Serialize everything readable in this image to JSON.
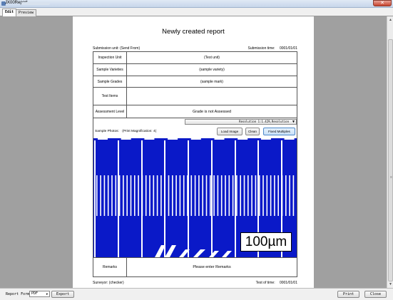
{
  "window": {
    "title": "JX00Report",
    "close_glyph": "✕"
  },
  "tabs": [
    {
      "label": "Edit"
    },
    {
      "label": "Preview"
    }
  ],
  "report": {
    "title": "Newly created report",
    "submission_unit_label": "Submission unit:",
    "submission_unit_value": "(Send From)",
    "submission_time_label": "Submission time:",
    "submission_time_value": "0001/01/01",
    "rows": [
      {
        "label": "Inspection Unit",
        "value": "(Test unit)"
      },
      {
        "label": "Sample Varieties",
        "value": "(sample variety)"
      },
      {
        "label": "Sample Grades",
        "value": "(sample mark)"
      },
      {
        "label": "Test Items",
        "value": ""
      },
      {
        "label": "Assessment Level",
        "value": "Grade is not Assessed"
      }
    ],
    "resolution_select": "Resolution 1:1.429,Resolution",
    "sample_photos_label": "Sample Photos:",
    "print_magnification": "(Print Magnification: 4(",
    "load_image_button": "Load Image",
    "clean_button": "Clean",
    "fixed_multiples_button": "Fixed Multiples",
    "scale_label": "100µm",
    "remarks_label": "Remarks",
    "remarks_placeholder": "Please enter Remarks",
    "surveyor_label": "Surveyor:",
    "surveyor_value": "(checker)",
    "test_time_label": "Test of time:",
    "test_time_value": "0001/01/01"
  },
  "bottom": {
    "format_label": "Report Forma",
    "format_value": "PDF",
    "export_button": "Export",
    "print_button": "Print",
    "close_button": "Close"
  },
  "colors": {
    "photo_background": "#0a19c8",
    "photo_lines": "#ffffff"
  }
}
